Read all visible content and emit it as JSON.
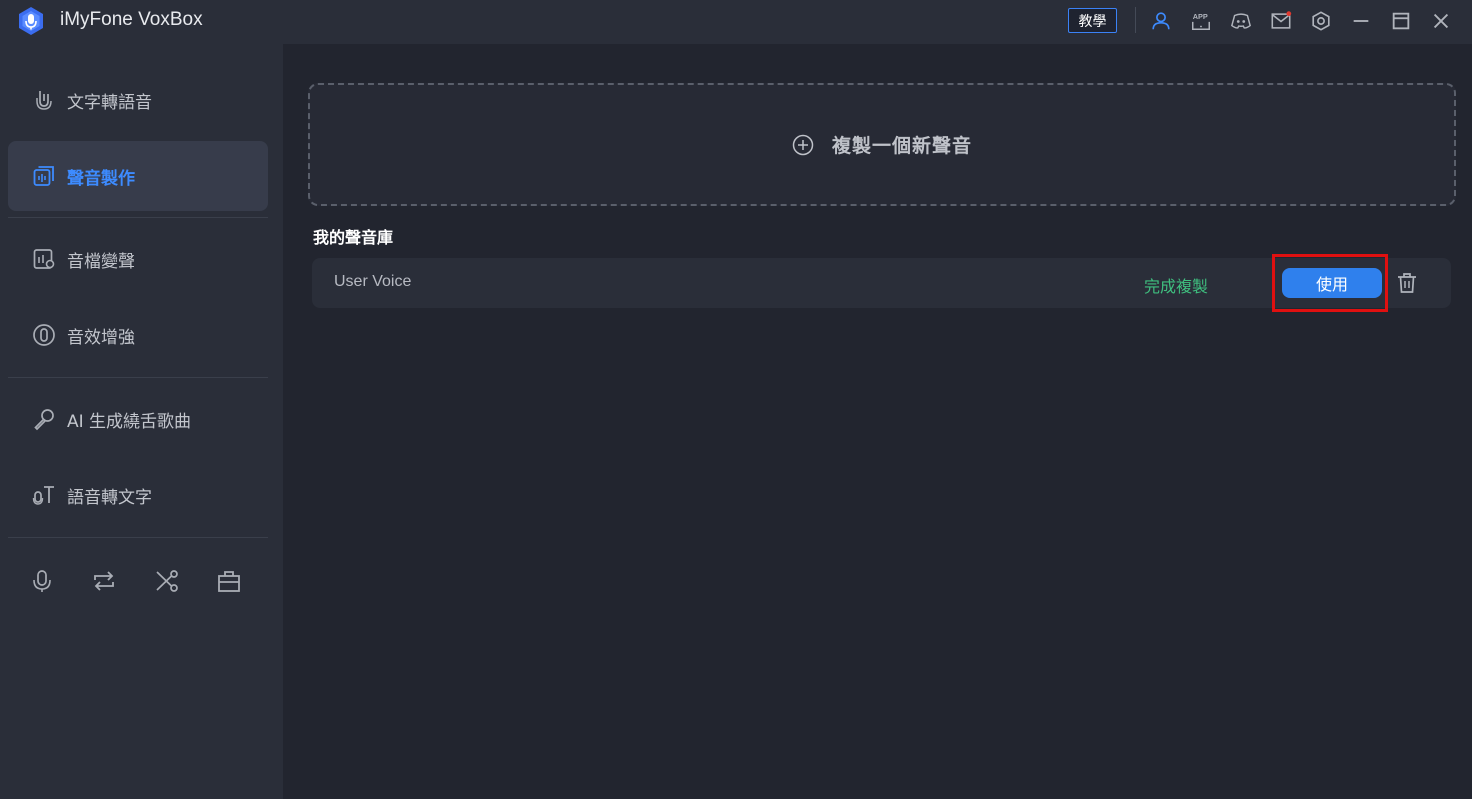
{
  "app": {
    "title": "iMyFone VoxBox"
  },
  "titlebar": {
    "tutorial_label": "教學",
    "icons": [
      "user-icon",
      "app-icon",
      "discord-icon",
      "mail-icon",
      "settings-icon",
      "minimize-icon",
      "maximize-icon",
      "close-icon"
    ]
  },
  "sidebar": {
    "items": [
      {
        "label": "文字轉語音",
        "icon": "mic-text-icon"
      },
      {
        "label": "聲音製作",
        "icon": "voice-clone-icon",
        "active": true
      },
      {
        "label": "音檔變聲",
        "icon": "voice-changer-icon"
      },
      {
        "label": "音效增強",
        "icon": "audio-enhance-icon"
      },
      {
        "label": "AI 生成繞舌歌曲",
        "icon": "microphone-icon"
      },
      {
        "label": "語音轉文字",
        "icon": "speech-to-text-icon"
      }
    ],
    "tools": [
      "record-icon",
      "convert-icon",
      "cut-icon",
      "toolbox-icon"
    ]
  },
  "main": {
    "clone_label": "複製一個新聲音",
    "library_title": "我的聲音庫",
    "voices": [
      {
        "name": "User Voice",
        "status": "完成複製",
        "use_label": "使用"
      }
    ]
  },
  "colors": {
    "accent": "#2f80ed",
    "active_text": "#3d8bff",
    "status_green": "#3fbf7f",
    "highlight_red": "#e01010"
  }
}
